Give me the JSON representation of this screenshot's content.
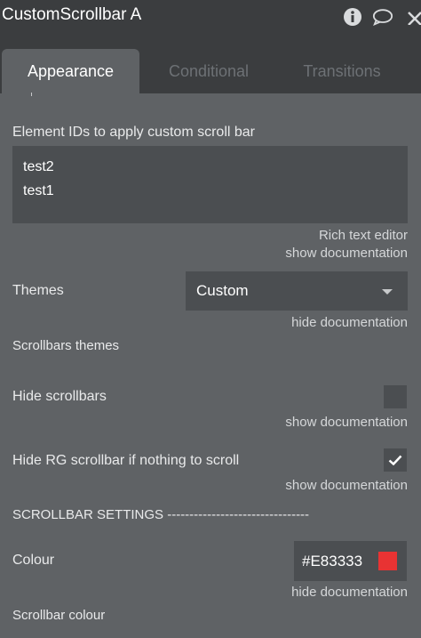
{
  "header": {
    "title": "CustomScrollbar A",
    "icons": [
      "info-icon",
      "comment-icon",
      "close-icon"
    ]
  },
  "tabs": [
    {
      "label": "Appearance",
      "active": true
    },
    {
      "label": "Conditional",
      "active": false
    },
    {
      "label": "Transitions",
      "active": false
    }
  ],
  "element_ids": {
    "label": "Element IDs to apply custom scroll bar",
    "lines": [
      "test2",
      "test1"
    ],
    "rich_text_link": "Rich text editor",
    "doc_link": "show documentation"
  },
  "themes": {
    "label": "Themes",
    "value": "Custom",
    "doc_link": "hide documentation",
    "description": "Scrollbars themes"
  },
  "hide_scrollbars": {
    "label": "Hide scrollbars",
    "checked": false,
    "doc_link": "show documentation"
  },
  "hide_rg": {
    "label": "Hide RG scrollbar if nothing to scroll",
    "checked": true,
    "doc_link": "show documentation"
  },
  "section_heading": "SCROLLBAR SETTINGS --------------------------------",
  "colour": {
    "label": "Colour",
    "value": "#E83333",
    "doc_link": "hide documentation",
    "description": "Scrollbar colour"
  },
  "colors": {
    "panel_bg": "#5f6265",
    "header_bg": "#3b3d3f",
    "input_bg": "#4b4e51",
    "swatch": "#E83333"
  }
}
